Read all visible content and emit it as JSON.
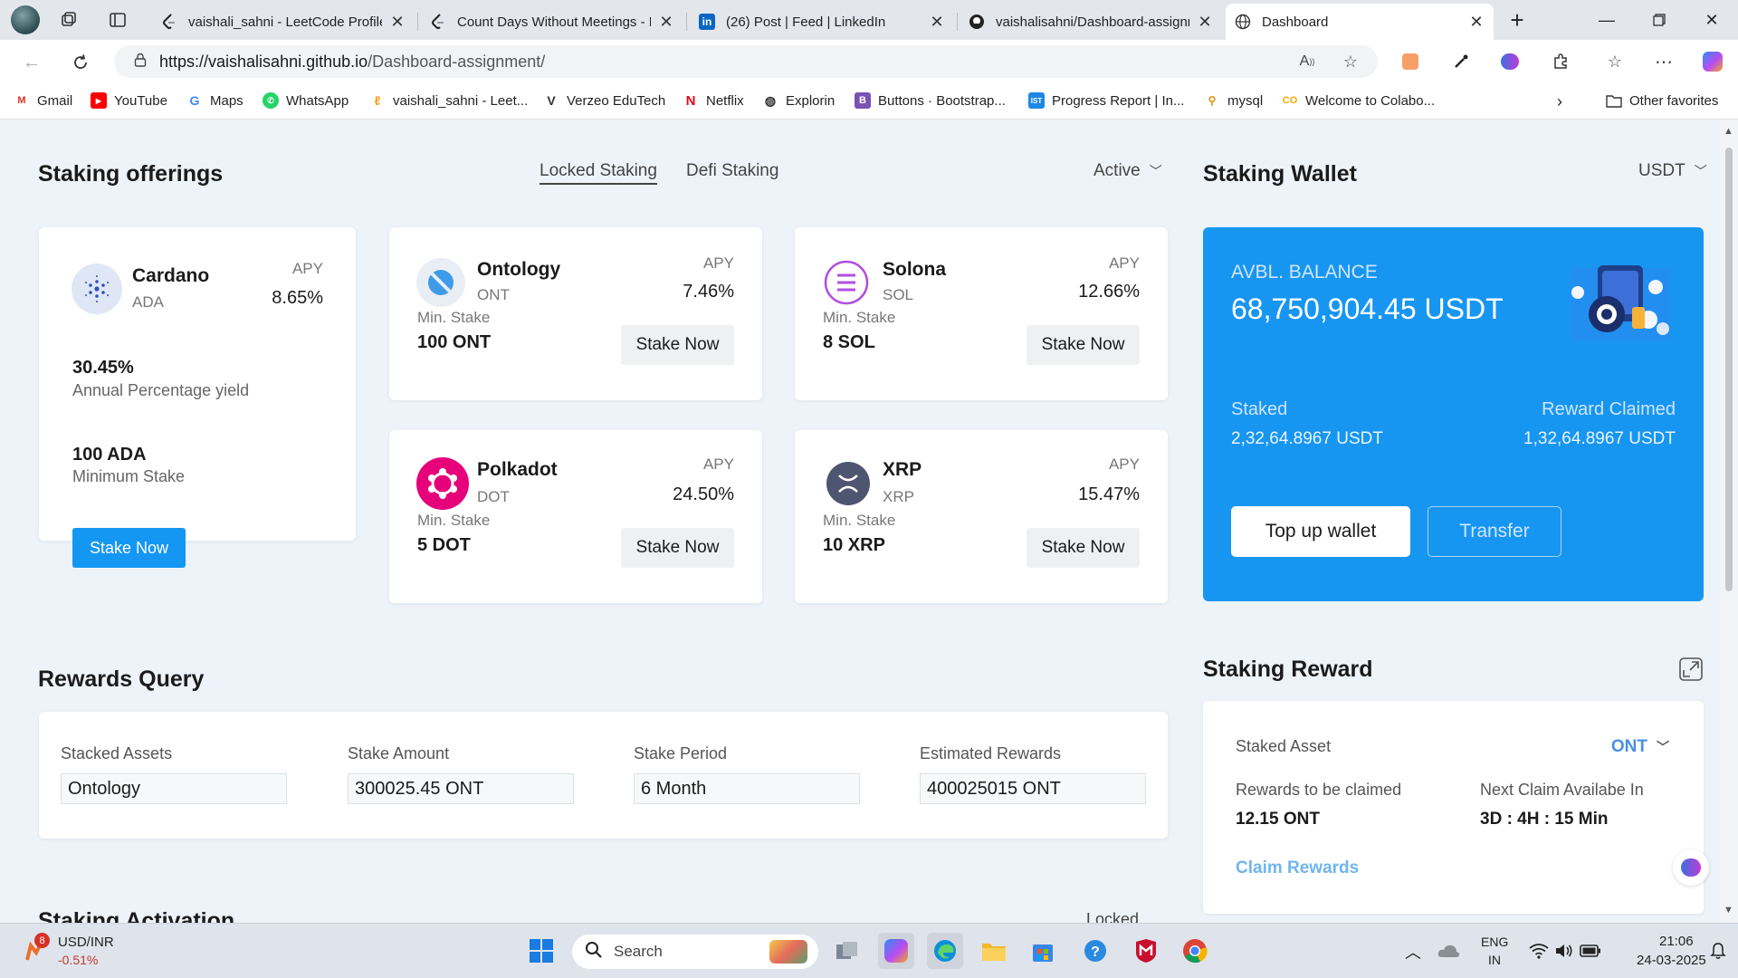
{
  "browser": {
    "tabs": [
      {
        "title": "vaishali_sahni - LeetCode Profile",
        "favicon": "leetcode-icon"
      },
      {
        "title": "Count Days Without Meetings - L",
        "favicon": "leetcode-icon"
      },
      {
        "title": "(26) Post | Feed | LinkedIn",
        "favicon": "linkedin-icon"
      },
      {
        "title": "vaishalisahni/Dashboard-assignm",
        "favicon": "github-icon"
      },
      {
        "title": "Dashboard",
        "favicon": "globe-icon"
      }
    ],
    "url_host": "https://vaishalisahni.github.io",
    "url_path": "/Dashboard-assignment/",
    "bookmarks": [
      "Gmail",
      "YouTube",
      "Maps",
      "WhatsApp",
      "vaishali_sahni - Leet...",
      "Verzeo EduTech",
      "Netflix",
      "Explorin",
      "Buttons · Bootstrap...",
      "Progress Report | In...",
      "mysql",
      "Welcome to Colabo..."
    ],
    "other_favorites": "Other favorites"
  },
  "offerings": {
    "title": "Staking offerings",
    "tabs": [
      "Locked Staking",
      "Defi Staking"
    ],
    "filter": "Active",
    "featured": {
      "name": "Cardano",
      "symbol": "ADA",
      "apy_label": "APY",
      "apy": "8.65%",
      "yield_value": "30.45%",
      "yield_label": "Annual Percentage yield",
      "min_value": "100 ADA",
      "min_label": "Minimum Stake",
      "button": "Stake Now"
    },
    "coins": [
      {
        "name": "Ontology",
        "symbol": "ONT",
        "apy_label": "APY",
        "apy": "7.46%",
        "min_label": "Min. Stake",
        "min": "100 ONT",
        "button": "Stake Now"
      },
      {
        "name": "Solona",
        "symbol": "SOL",
        "apy_label": "APY",
        "apy": "12.66%",
        "min_label": "Min. Stake",
        "min": "8 SOL",
        "button": "Stake Now"
      },
      {
        "name": "Polkadot",
        "symbol": "DOT",
        "apy_label": "APY",
        "apy": "24.50%",
        "min_label": "Min. Stake",
        "min": "5 DOT",
        "button": "Stake Now"
      },
      {
        "name": "XRP",
        "symbol": "XRP",
        "apy_label": "APY",
        "apy": "15.47%",
        "min_label": "Min. Stake",
        "min": "10 XRP",
        "button": "Stake Now"
      }
    ]
  },
  "wallet": {
    "title": "Staking Wallet",
    "currency": "USDT",
    "balance_label": "AVBL. BALANCE",
    "balance": "68,750,904.45 USDT",
    "staked_label": "Staked",
    "staked": "2,32,64.8967 USDT",
    "claimed_label": "Reward Claimed",
    "claimed": "1,32,64.8967 USDT",
    "topup": "Top up wallet",
    "transfer": "Transfer"
  },
  "rewards_query": {
    "title": "Rewards Query",
    "fields": [
      {
        "label": "Stacked Assets",
        "value": "Ontology"
      },
      {
        "label": "Stake Amount",
        "value": "300025.45 ONT"
      },
      {
        "label": "Stake Period",
        "value": "6 Month"
      },
      {
        "label": "Estimated Rewards",
        "value": "400025015 ONT"
      }
    ]
  },
  "staking_reward": {
    "title": "Staking Reward",
    "asset_label": "Staked Asset",
    "asset": "ONT",
    "to_claim_label": "Rewards to be claimed",
    "to_claim": "12.15 ONT",
    "next_label": "Next Claim Availabe In",
    "next": "3D : 4H : 15 Min",
    "claim": "Claim Rewards"
  },
  "next_section": {
    "title": "Staking Activation",
    "right": "Locked"
  },
  "taskbar": {
    "ticker_badge": "8",
    "ticker": "USD/INR",
    "ticker_change": "-0.51%",
    "search": "Search",
    "lang1": "ENG",
    "lang2": "IN",
    "time": "21:06",
    "date": "24-03-2025"
  },
  "colors": {
    "accent": "#1497f3",
    "wallet_bg": "#1796f1",
    "page_bg": "#eef3f9",
    "claim_link": "#6fb5ef"
  }
}
